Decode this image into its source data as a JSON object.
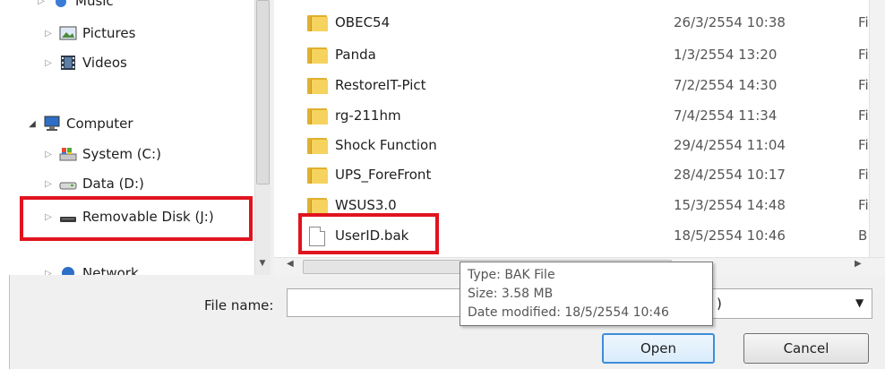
{
  "nav": {
    "items": [
      {
        "label": "Music",
        "icon": "music-icon"
      },
      {
        "label": "Pictures",
        "icon": "pictures-icon"
      },
      {
        "label": "Videos",
        "icon": "videos-icon"
      },
      {
        "label": "Computer",
        "icon": "computer-icon"
      },
      {
        "label": "System (C:)",
        "icon": "system-drive-icon"
      },
      {
        "label": "Data (D:)",
        "icon": "drive-icon"
      },
      {
        "label": "Removable Disk (J:)",
        "icon": "removable-disk-icon"
      },
      {
        "label": "Network",
        "icon": "network-icon"
      }
    ]
  },
  "files": [
    {
      "name": "OBEC54",
      "date": "26/3/2554 10:38",
      "type": "Fi",
      "icon": "folder-icon"
    },
    {
      "name": "Panda",
      "date": "1/3/2554 13:20",
      "type": "Fi",
      "icon": "folder-icon"
    },
    {
      "name": "RestoreIT-Pict",
      "date": "7/2/2554 14:30",
      "type": "Fi",
      "icon": "folder-icon"
    },
    {
      "name": "rg-211hm",
      "date": "7/4/2554 11:34",
      "type": "Fi",
      "icon": "folder-icon"
    },
    {
      "name": "Shock Function",
      "date": "29/4/2554 11:04",
      "type": "Fi",
      "icon": "folder-icon"
    },
    {
      "name": "UPS_ForeFront",
      "date": "28/4/2554 10:17",
      "type": "Fi",
      "icon": "folder-icon"
    },
    {
      "name": "WSUS3.0",
      "date": "15/3/2554 14:48",
      "type": "Fi",
      "icon": "folder-icon"
    },
    {
      "name": "UserID.bak",
      "date": "18/5/2554 10:46",
      "type": "B",
      "icon": "file-icon"
    }
  ],
  "tooltip": {
    "type": "Type: BAK File",
    "size": "Size: 3.58 MB",
    "modified": "Date modified: 18/5/2554 10:46"
  },
  "bottom": {
    "filename_label": "File name:",
    "filename_value": "",
    "filetype_visible": ")",
    "open_label": "Open",
    "cancel_label": "Cancel"
  },
  "colors": {
    "highlight": "#e0141e",
    "selected_button_border": "#3c8ddb",
    "folder": "#f6d35e"
  }
}
